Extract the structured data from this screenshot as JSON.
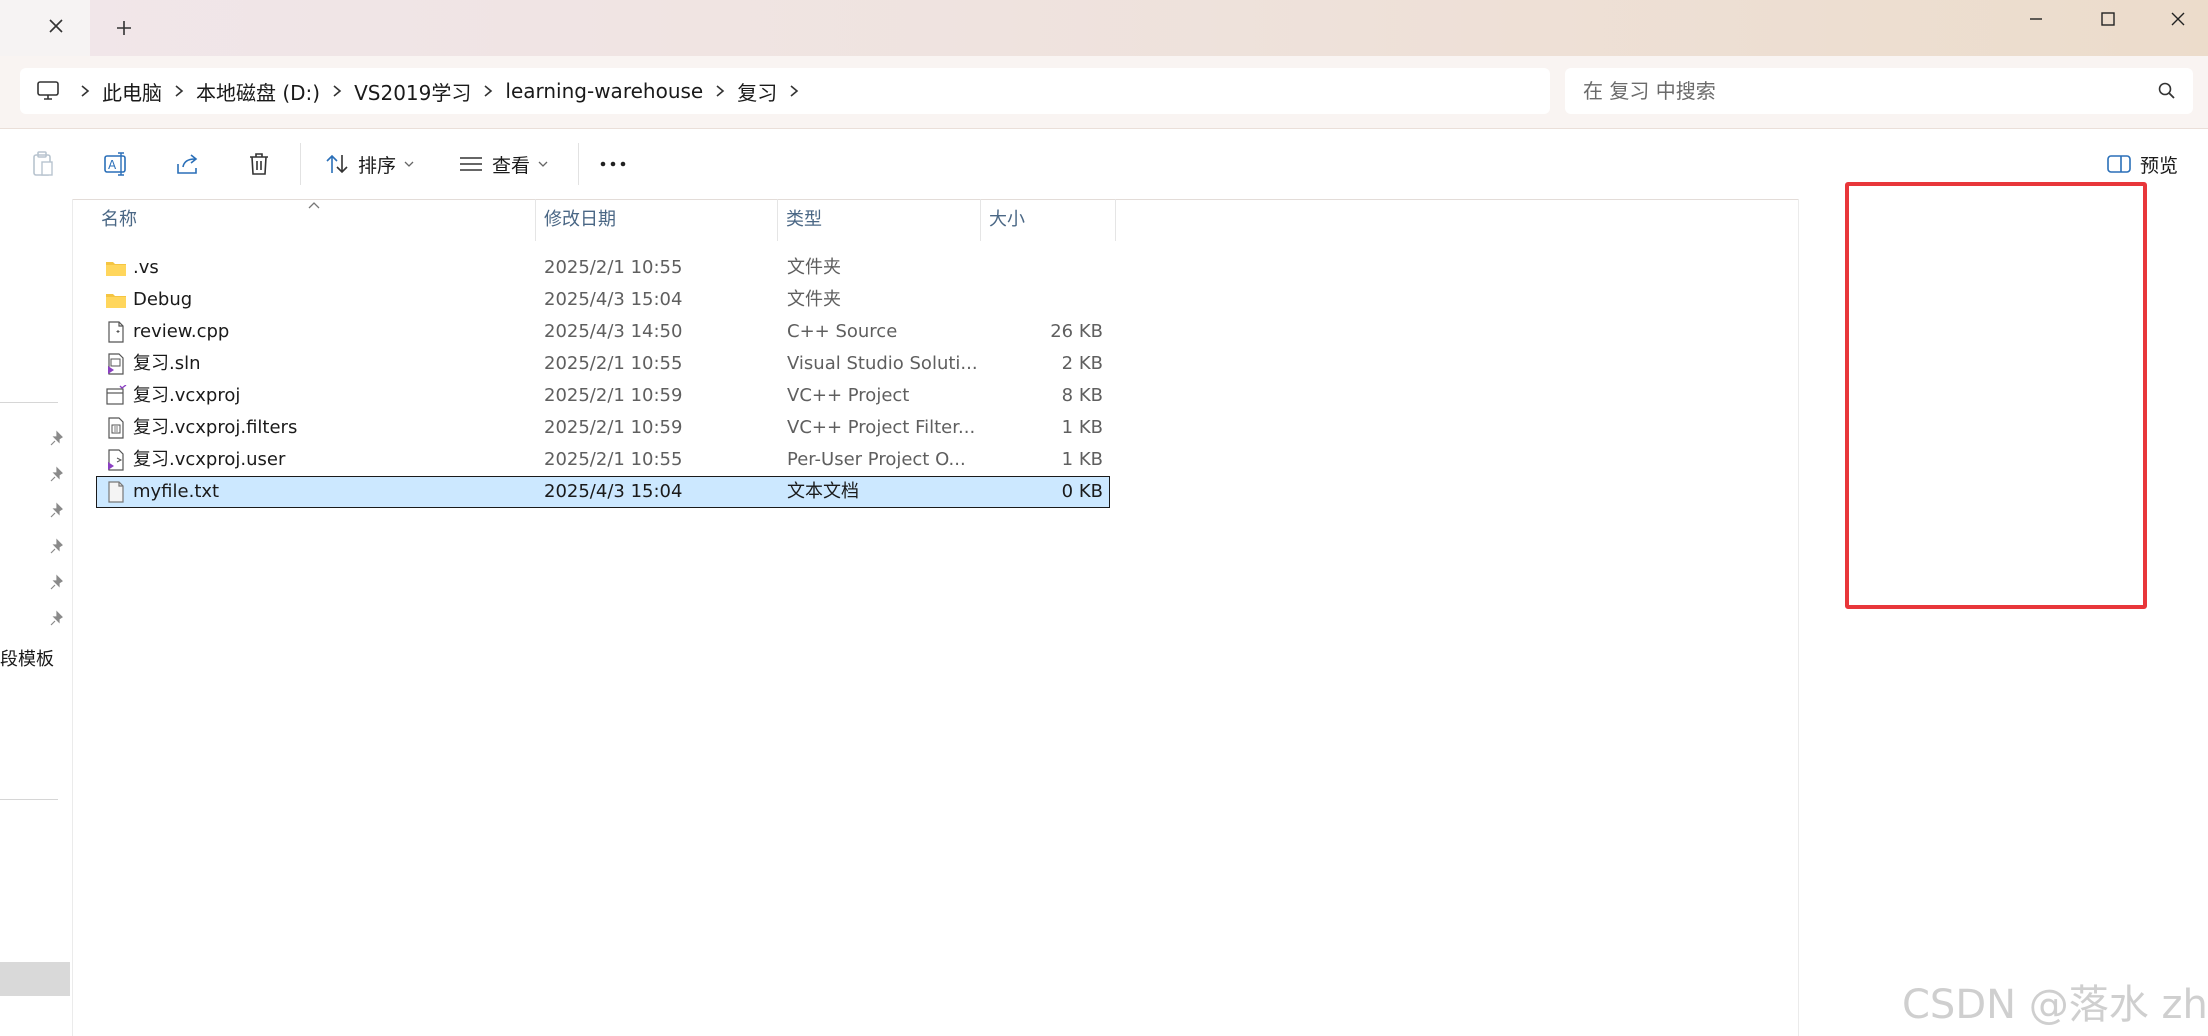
{
  "addressbar": {
    "breadcrumbs": [
      "此电脑",
      "本地磁盘 (D:)",
      "VS2019学习",
      "learning-warehouse",
      "复习"
    ]
  },
  "search": {
    "placeholder": "在 复习 中搜索"
  },
  "toolbar": {
    "sort_label": "排序",
    "view_label": "查看",
    "more_label": "···",
    "preview_label": "预览"
  },
  "nav": {
    "partial_label": "段模板"
  },
  "columns": {
    "name": "名称",
    "date": "修改日期",
    "type": "类型",
    "size": "大小"
  },
  "files": [
    {
      "name": ".vs",
      "date": "2025/2/1 10:55",
      "type": "文件夹",
      "size": "",
      "icon": "folder-icon"
    },
    {
      "name": "Debug",
      "date": "2025/4/3 15:04",
      "type": "文件夹",
      "size": "",
      "icon": "folder-icon"
    },
    {
      "name": "review.cpp",
      "date": "2025/4/3 14:50",
      "type": "C++ Source",
      "size": "26 KB",
      "icon": "cpp-file-icon"
    },
    {
      "name": "复习.sln",
      "date": "2025/2/1 10:55",
      "type": "Visual Studio Soluti...",
      "size": "2 KB",
      "icon": "sln-file-icon"
    },
    {
      "name": "复习.vcxproj",
      "date": "2025/2/1 10:59",
      "type": "VC++ Project",
      "size": "8 KB",
      "icon": "vcxproj-file-icon"
    },
    {
      "name": "复习.vcxproj.filters",
      "date": "2025/2/1 10:59",
      "type": "VC++ Project Filter...",
      "size": "1 KB",
      "icon": "filters-file-icon"
    },
    {
      "name": "复习.vcxproj.user",
      "date": "2025/2/1 10:55",
      "type": "Per-User Project O...",
      "size": "1 KB",
      "icon": "user-file-icon"
    },
    {
      "name": "myfile.txt",
      "date": "2025/4/3 15:04",
      "type": "文本文档",
      "size": "0 KB",
      "icon": "txt-file-icon",
      "selected": true
    }
  ],
  "watermark": "CSDN @落水 zh",
  "colors": {
    "selection": "#cce8ff",
    "highlight_box": "#e8363a",
    "folder": "#f5c542",
    "header_text": "#4a6785"
  }
}
